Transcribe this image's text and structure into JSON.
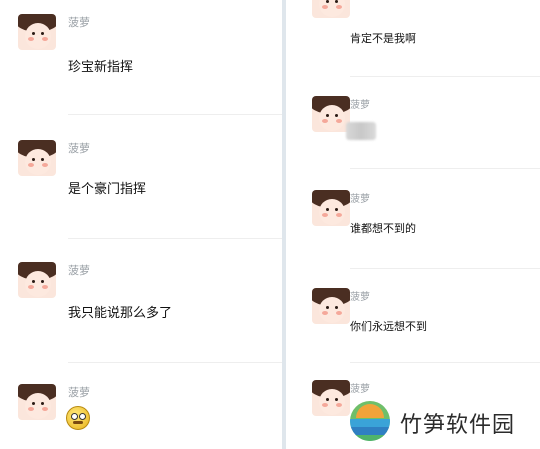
{
  "left_panel": {
    "messages": [
      {
        "sender": "菠萝",
        "text": "珍宝新指挥"
      },
      {
        "sender": "菠萝",
        "text": "是个豪门指挥"
      },
      {
        "sender": "菠萝",
        "text": "我只能说那么多了"
      },
      {
        "sender": "菠萝",
        "emoji": "smiley-emoji-icon"
      }
    ]
  },
  "right_panel": {
    "messages": [
      {
        "text": "肯定不是我啊"
      },
      {
        "sender": "菠萝",
        "blurred": true
      },
      {
        "sender": "菠萝",
        "text": "谁都想不到的"
      },
      {
        "sender": "菠萝",
        "text": "你们永远想不到"
      },
      {
        "sender": "菠萝"
      }
    ]
  },
  "watermark": {
    "text": "竹笋软件园",
    "logo": "site-logo-icon"
  },
  "colors": {
    "background": "#ffffff",
    "divider": "#dfe6ec",
    "name": "#9aa0a6",
    "text": "#111111"
  }
}
